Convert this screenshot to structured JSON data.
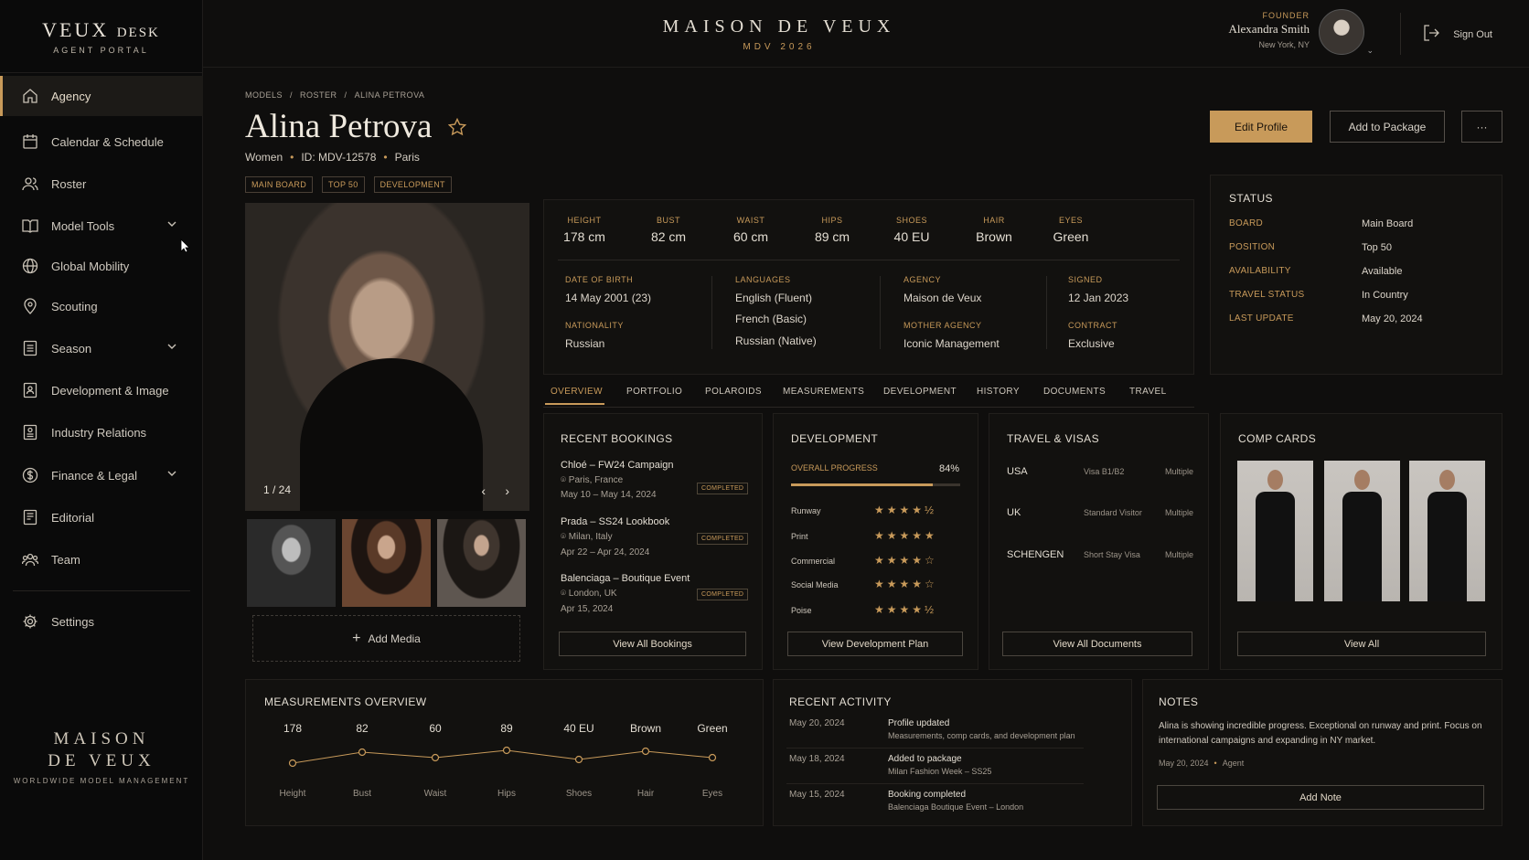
{
  "app": {
    "logo_main": "VEUX",
    "logo_suffix": "DESK",
    "logo_sub": "AGENT PORTAL",
    "title": "MAISON DE VEUX",
    "subtitle": "MDV 2026",
    "footer_line1": "MAISON",
    "footer_line2": "DE VEUX",
    "footer_tagline": "WORLDWIDE MODEL MANAGEMENT"
  },
  "user": {
    "role": "FOUNDER",
    "name": "Alexandra Smith",
    "location": "New York, NY",
    "sign_out": "Sign Out"
  },
  "sidebar": {
    "items": [
      {
        "label": "Agency",
        "icon": "home-icon"
      },
      {
        "label": "Calendar & Schedule",
        "icon": "calendar-icon"
      },
      {
        "label": "Roster",
        "icon": "people-icon"
      },
      {
        "label": "Model Tools",
        "icon": "book-icon"
      },
      {
        "label": "Global Mobility",
        "icon": "globe-icon"
      },
      {
        "label": "Scouting",
        "icon": "pin-icon"
      },
      {
        "label": "Season",
        "icon": "list-icon"
      },
      {
        "label": "Development & Image",
        "icon": "person-doc-icon"
      },
      {
        "label": "Industry Relations",
        "icon": "person-card-icon"
      },
      {
        "label": "Finance & Legal",
        "icon": "dollar-icon"
      },
      {
        "label": "Editorial",
        "icon": "doc-icon"
      },
      {
        "label": "Team",
        "icon": "team-icon"
      },
      {
        "label": "Settings",
        "icon": "gear-icon"
      }
    ]
  },
  "breadcrumb": [
    "MODELS",
    "ROSTER",
    "ALINA PETROVA"
  ],
  "model": {
    "name": "Alina Petrova",
    "division": "Women",
    "id": "ID: MDV-12578",
    "city": "Paris",
    "tags": [
      "MAIN BOARD",
      "TOP 50",
      "DEVELOPMENT"
    ]
  },
  "actions": {
    "edit": "Edit Profile",
    "package": "Add to Package",
    "more": "···"
  },
  "gallery": {
    "counter": "1 / 24",
    "add_media": "Add Media"
  },
  "stats": [
    {
      "label": "HEIGHT",
      "value": "178 cm"
    },
    {
      "label": "BUST",
      "value": "82 cm"
    },
    {
      "label": "WAIST",
      "value": "60 cm"
    },
    {
      "label": "HIPS",
      "value": "89 cm"
    },
    {
      "label": "SHOES",
      "value": "40 EU"
    },
    {
      "label": "HAIR",
      "value": "Brown"
    },
    {
      "label": "EYES",
      "value": "Green"
    }
  ],
  "details": {
    "dob_label": "DATE OF BIRTH",
    "dob": "14 May 2001 (23)",
    "nationality_label": "NATIONALITY",
    "nationality": "Russian",
    "languages_label": "LANGUAGES",
    "languages": [
      "English (Fluent)",
      "French (Basic)",
      "Russian (Native)"
    ],
    "agency_label": "AGENCY",
    "agency": "Maison de Veux",
    "mother_label": "MOTHER AGENCY",
    "mother": "Iconic Management",
    "signed_label": "SIGNED",
    "signed": "12 Jan 2023",
    "contract_label": "CONTRACT",
    "contract": "Exclusive"
  },
  "status": {
    "title": "STATUS",
    "rows": [
      {
        "k": "BOARD",
        "v": "Main Board"
      },
      {
        "k": "POSITION",
        "v": "Top 50"
      },
      {
        "k": "AVAILABILITY",
        "v": "Available"
      },
      {
        "k": "TRAVEL STATUS",
        "v": "In Country"
      },
      {
        "k": "LAST UPDATE",
        "v": "May 20, 2024"
      }
    ]
  },
  "tabs": [
    "OVERVIEW",
    "PORTFOLIO",
    "POLAROIDS",
    "MEASUREMENTS",
    "DEVELOPMENT",
    "HISTORY",
    "DOCUMENTS",
    "TRAVEL"
  ],
  "bookings": {
    "title": "RECENT BOOKINGS",
    "items": [
      {
        "title": "Chloé – FW24 Campaign",
        "location": "Paris, France",
        "dates": "May 10 – May 14, 2024",
        "status": "COMPLETED"
      },
      {
        "title": "Prada – SS24 Lookbook",
        "location": "Milan, Italy",
        "dates": "Apr 22 – Apr 24, 2024",
        "status": "COMPLETED"
      },
      {
        "title": "Balenciaga – Boutique Event",
        "location": "London, UK",
        "dates": "Apr 15, 2024",
        "status": "COMPLETED"
      }
    ],
    "button": "View All Bookings"
  },
  "development": {
    "title": "DEVELOPMENT",
    "progress_label": "OVERALL PROGRESS",
    "progress_text": "84%",
    "progress": 0.84,
    "ratings": [
      {
        "label": "Runway",
        "stars": "★★★★½",
        "value": 4.5
      },
      {
        "label": "Print",
        "stars": "★★★★★",
        "value": 5
      },
      {
        "label": "Commercial",
        "stars": "★★★★☆",
        "value": 4
      },
      {
        "label": "Social Media",
        "stars": "★★★★☆",
        "value": 4
      },
      {
        "label": "Poise",
        "stars": "★★★★½",
        "value": 4.5
      }
    ],
    "button": "View Development Plan"
  },
  "travel": {
    "title": "TRAVEL & VISAS",
    "rows": [
      {
        "country": "USA",
        "visa": "Visa B1/B2",
        "entry": "Multiple"
      },
      {
        "country": "UK",
        "visa": "Standard Visitor",
        "entry": "Multiple"
      },
      {
        "country": "SCHENGEN",
        "visa": "Short Stay Visa",
        "entry": "Multiple"
      }
    ],
    "button": "View All Documents"
  },
  "comp": {
    "title": "COMP CARDS",
    "button": "View All"
  },
  "measurements": {
    "title": "MEASUREMENTS OVERVIEW",
    "values": [
      "178",
      "82",
      "60",
      "89",
      "40 EU",
      "Brown",
      "Green"
    ],
    "labels": [
      "Height",
      "Bust",
      "Waist",
      "Hips",
      "Shoes",
      "Hair",
      "Eyes"
    ]
  },
  "activity": {
    "title": "RECENT ACTIVITY",
    "items": [
      {
        "date": "May 20, 2024",
        "title": "Profile updated",
        "sub": "Measurements, comp cards, and development plan"
      },
      {
        "date": "May 18, 2024",
        "title": "Added to package",
        "sub": "Milan Fashion Week – SS25"
      },
      {
        "date": "May 15, 2024",
        "title": "Booking completed",
        "sub": "Balenciaga Boutique Event – London"
      }
    ]
  },
  "notes": {
    "title": "NOTES",
    "text": "Alina is showing incredible progress. Exceptional on runway and print. Focus on international campaigns and expanding in NY market.",
    "date": "May 20, 2024",
    "author": "Agent",
    "button": "Add Note"
  },
  "colors": {
    "accent": "#c89a5a",
    "background": "#0f0e0d",
    "sidebar": "#0a0a0a"
  }
}
